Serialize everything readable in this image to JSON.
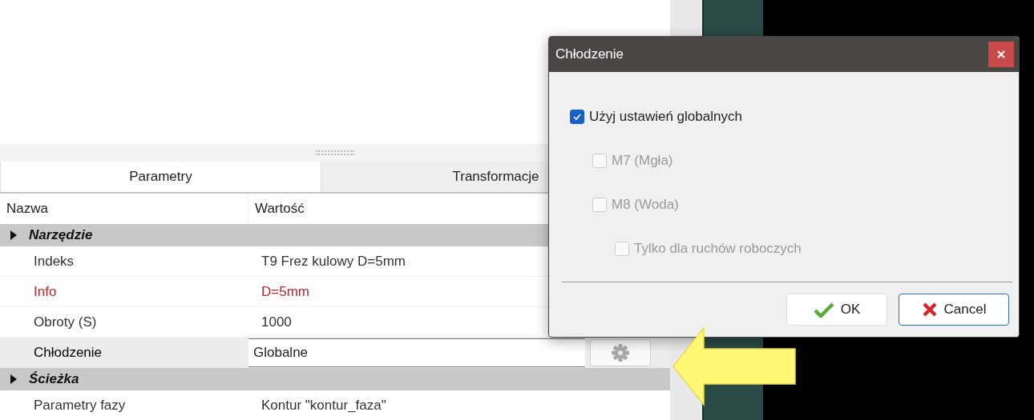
{
  "panel": {
    "tabs": [
      {
        "label": "Parametry",
        "selected": true
      },
      {
        "label": "Transformacje",
        "selected": false
      }
    ],
    "columns": [
      "Nazwa",
      "Wartość"
    ],
    "rows": [
      {
        "kind": "group",
        "name": "Narzędzie",
        "expanded": false
      },
      {
        "kind": "property",
        "name": "Indeks",
        "value": "T9 Frez kulowy D=5mm",
        "color": "#333333"
      },
      {
        "kind": "property",
        "name": "Info",
        "value": "D=5mm",
        "color": "#c0262d"
      },
      {
        "kind": "property",
        "name": "Obroty (S)",
        "value": "1000",
        "color": "#333333"
      },
      {
        "kind": "field",
        "name": "Chłodzenie",
        "value": "Globalne"
      },
      {
        "kind": "group",
        "name": "Ścieżka",
        "expanded": false
      },
      {
        "kind": "property",
        "name": "Parametry fazy",
        "value": "Kontur \"kontur_faza\"",
        "color": "#333333"
      }
    ]
  },
  "dialog": {
    "title": "Chłodzenie",
    "options": [
      {
        "label": "Użyj ustawień globalnych",
        "checked": true,
        "disabled": false,
        "children": [
          {
            "label": "M7 (Mgła)",
            "checked": false,
            "disabled": true
          },
          {
            "label": "M8 (Woda)",
            "checked": false,
            "disabled": true,
            "children": [
              {
                "label": "Tylko dla ruchów roboczych",
                "checked": false,
                "disabled": true
              }
            ]
          }
        ]
      }
    ],
    "buttons": [
      {
        "label": "OK",
        "kind": "ok",
        "focused": false
      },
      {
        "label": "Cancel",
        "kind": "cancel",
        "focused": true
      }
    ]
  }
}
